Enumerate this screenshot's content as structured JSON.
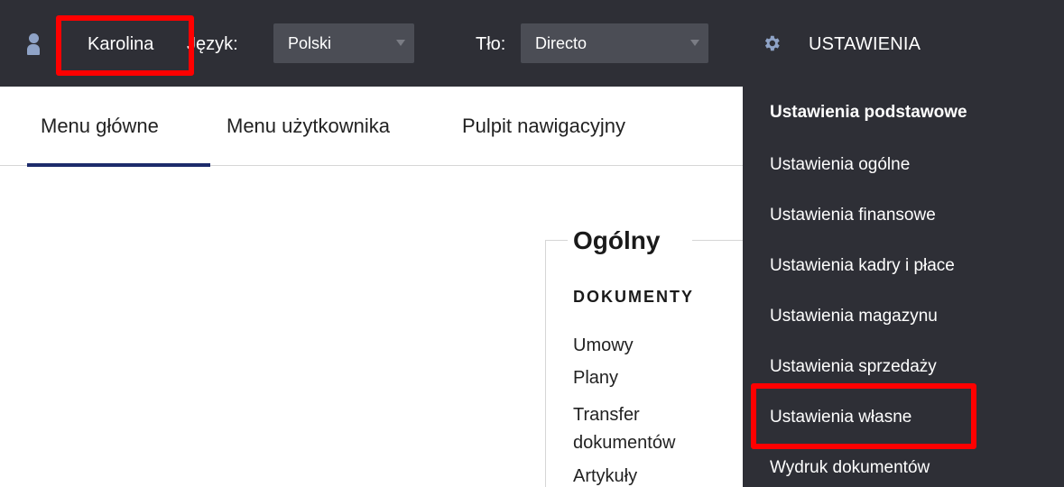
{
  "topbar": {
    "user_name": "Karolina",
    "language_label": "Język:",
    "language_value": "Polski",
    "background_label": "Tło:",
    "background_value": "Directo",
    "settings_label": "USTAWIENIA",
    "icons": [
      "user-icon",
      "gear-icon"
    ]
  },
  "tabs": [
    {
      "label": "Menu główne",
      "active": true
    },
    {
      "label": "Menu użytkownika",
      "active": false
    },
    {
      "label": "Pulpit nawigacyjny",
      "active": false
    }
  ],
  "panel": {
    "title": "Ogólny",
    "section": "DOKUMENTY",
    "links": [
      "Umowy",
      "Plany",
      "Transfer",
      "dokumentów",
      "Artykuły"
    ]
  },
  "settings_menu": {
    "header": "Ustawienia podstawowe",
    "items": [
      "Ustawienia ogólne",
      "Ustawienia finansowe",
      "Ustawienia kadry i płace",
      "Ustawienia magazynu",
      "Ustawienia sprzedaży",
      "Ustawienia własne",
      "Wydruk dokumentów"
    ]
  },
  "colors": {
    "topbar_bg": "#2e2f36",
    "select_bg": "#4b4d55",
    "tab_underline": "#1c2b6b",
    "highlight": "#ff0000",
    "user_icon": "#8fa3c7"
  }
}
